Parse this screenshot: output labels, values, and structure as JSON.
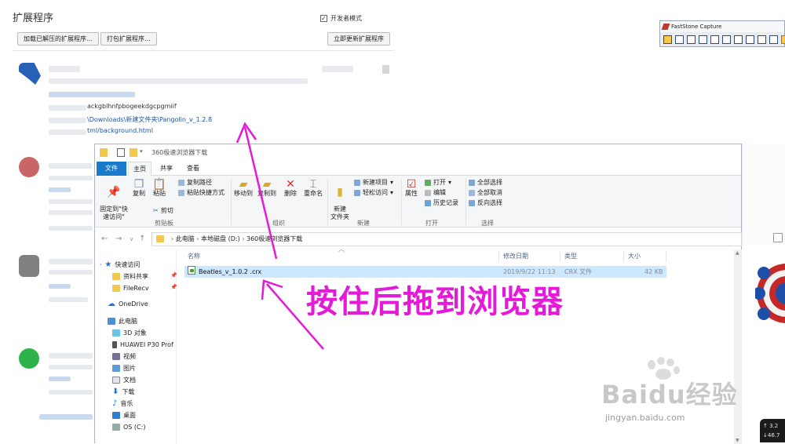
{
  "extensions_page": {
    "title": "扩展程序",
    "developer_mode_label": "开发者模式",
    "developer_mode_checked": true,
    "load_unpacked_button": "加载已解压的扩展程序...",
    "pack_button": "打包扩展程序...",
    "update_now_button": "立即更新扩展程序",
    "visible_id_fragment": "ackgblhnfpbogeekdgcpgmiif",
    "load_path_fragment": "\\Downloads\\新建文件夹\\Pangolin_v_1.2.8",
    "background_page_fragment": "tml/background.html"
  },
  "faststone": {
    "title": "FastStone Capture"
  },
  "explorer": {
    "window_title": "360极速浏览器下载",
    "ribbon_tabs": [
      "文件",
      "主页",
      "共享",
      "查看"
    ],
    "ribbon": {
      "pin_quick_access": "固定到\"快\n速访问\"",
      "copy": "复制",
      "paste": "粘贴",
      "copy_path": "复制路径",
      "paste_shortcut": "粘贴快捷方式",
      "cut": "剪切",
      "clipboard_group": "剪贴板",
      "move_to": "移动到",
      "copy_to": "复制到",
      "delete": "删除",
      "rename": "重命名",
      "organize_group": "组织",
      "new_item": "新建项目",
      "easy_access": "轻松访问",
      "new_folder": "新建\n文件夹",
      "new_group": "新建",
      "properties": "属性",
      "open": "打开",
      "edit": "编辑",
      "history": "历史记录",
      "open_group": "打开",
      "select_all": "全部选择",
      "select_none": "全部取消",
      "invert_selection": "反向选择",
      "select_group": "选择"
    },
    "address": [
      "此电脑",
      "本地磁盘 (D:)",
      "360极速浏览器下载"
    ],
    "nav_pane": [
      {
        "label": "快速访问",
        "icon": "star-icon"
      },
      {
        "label": "资料共享",
        "icon": "folder-icon"
      },
      {
        "label": "FileRecv",
        "icon": "folder-icon"
      },
      {
        "label": "OneDrive",
        "icon": "cloud-icon"
      },
      {
        "label": "此电脑",
        "icon": "computer-icon"
      },
      {
        "label": "3D 对象",
        "icon": "cube-icon"
      },
      {
        "label": "HUAWEI P30 Prof",
        "icon": "phone-icon"
      },
      {
        "label": "视频",
        "icon": "video-icon"
      },
      {
        "label": "图片",
        "icon": "picture-icon"
      },
      {
        "label": "文档",
        "icon": "document-icon"
      },
      {
        "label": "下载",
        "icon": "download-icon"
      },
      {
        "label": "音乐",
        "icon": "music-icon"
      },
      {
        "label": "桌面",
        "icon": "desktop-icon"
      },
      {
        "label": "OS (C:)",
        "icon": "drive-icon"
      }
    ],
    "columns": {
      "name": "名称",
      "modified": "修改日期",
      "type": "类型",
      "size": "大小"
    },
    "files": [
      {
        "name": "Beatles_v_1.0.2 .crx",
        "modified": "2019/9/22 11:13",
        "type": "CRX 文件",
        "size": "42 KB"
      }
    ]
  },
  "annotation": "按住后拖到浏览器",
  "watermark": {
    "logo_text": "Baidu经验",
    "url": "jingyan.baidu.com"
  },
  "net_speed": [
    "3.2",
    "46.7"
  ],
  "colors": {
    "annotation": "#e41ad8",
    "explorer_file_tab": "#1979ca",
    "selection": "#cce8ff",
    "link": "#1a55a8"
  }
}
